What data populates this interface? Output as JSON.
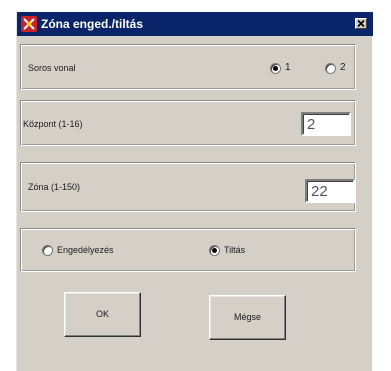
{
  "window": {
    "title": "Zóna enged./tiltás",
    "close_glyph": "×"
  },
  "soros": {
    "label": "Soros vonal",
    "options": [
      {
        "label": "1",
        "checked": true
      },
      {
        "label": "2",
        "checked": false
      }
    ]
  },
  "kozpont": {
    "label": "Központ (1-16)",
    "value": "2"
  },
  "zona": {
    "label": "Zóna (1-150)",
    "value": "22"
  },
  "mode": {
    "options": [
      {
        "label": "Engedélyezés",
        "checked": false
      },
      {
        "label": "Tiltás",
        "checked": true
      }
    ]
  },
  "buttons": {
    "ok": "OK",
    "cancel": "Mégse"
  },
  "colors": {
    "titlebar": "#0a246a",
    "dialog_bg": "#d4d0c8",
    "app_icon": "#c8232c"
  }
}
